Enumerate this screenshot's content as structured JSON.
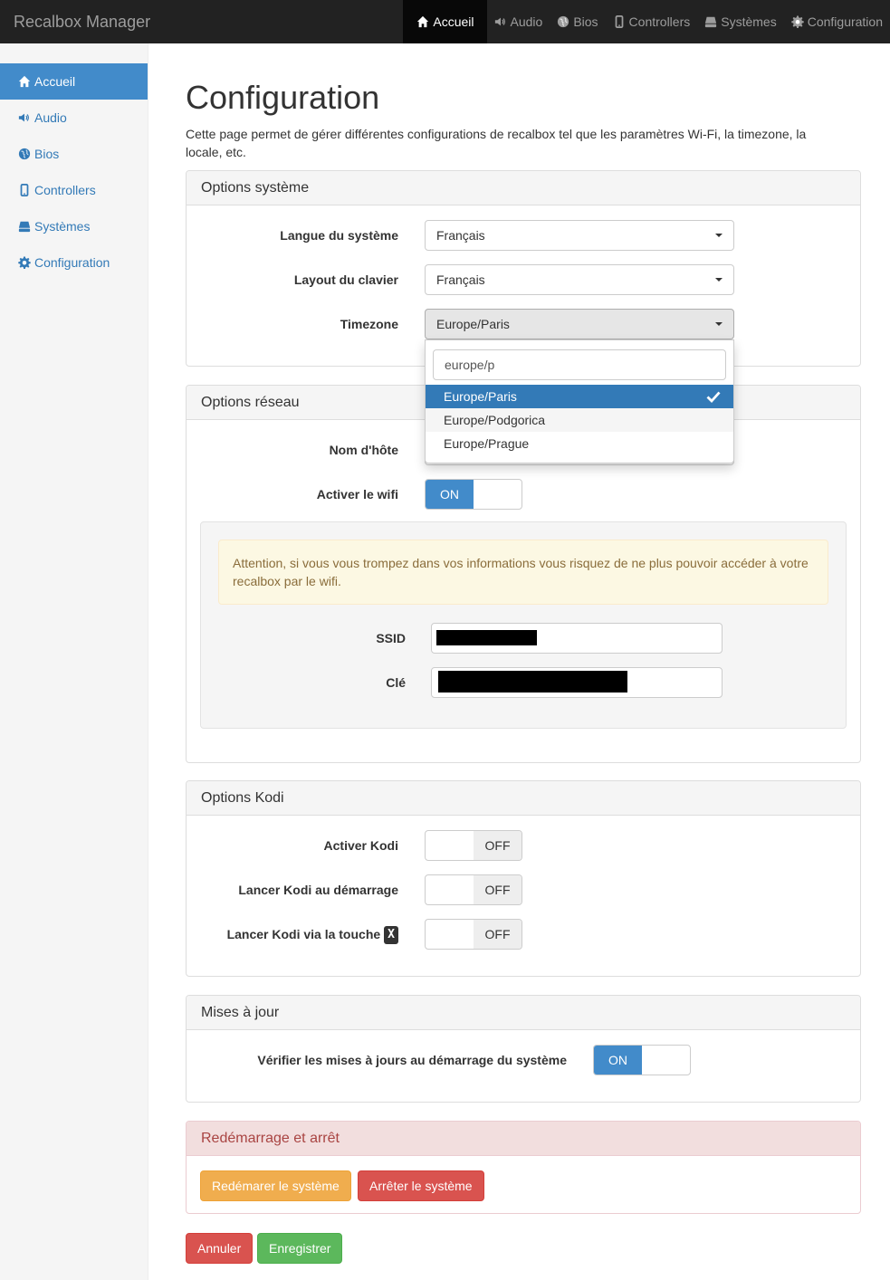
{
  "navbar": {
    "brand": "Recalbox Manager",
    "items": [
      {
        "label": "Accueil",
        "icon": "home-icon",
        "active": true
      },
      {
        "label": "Audio",
        "icon": "volume-icon"
      },
      {
        "label": "Bios",
        "icon": "globe-icon"
      },
      {
        "label": "Controllers",
        "icon": "phone-icon"
      },
      {
        "label": "Systèmes",
        "icon": "hdd-icon"
      },
      {
        "label": "Configuration",
        "icon": "gear-icon"
      }
    ]
  },
  "sidebar": {
    "items": [
      {
        "label": "Accueil",
        "icon": "home-icon",
        "active": true
      },
      {
        "label": "Audio",
        "icon": "volume-icon"
      },
      {
        "label": "Bios",
        "icon": "globe-icon"
      },
      {
        "label": "Controllers",
        "icon": "phone-icon"
      },
      {
        "label": "Systèmes",
        "icon": "hdd-icon"
      },
      {
        "label": "Configuration",
        "icon": "gear-icon"
      }
    ]
  },
  "page": {
    "title": "Configuration",
    "intro": "Cette page permet de gérer différentes configurations de recalbox tel que les paramètres Wi-Fi, la timezone, la locale, etc."
  },
  "system": {
    "heading": "Options système",
    "language_label": "Langue du système",
    "language_value": "Français",
    "keyboard_label": "Layout du clavier",
    "keyboard_value": "Français",
    "timezone_label": "Timezone",
    "timezone_value": "Europe/Paris"
  },
  "timezone_dropdown": {
    "search": "europe/p",
    "options": [
      "Europe/Paris",
      "Europe/Podgorica",
      "Europe/Prague"
    ],
    "selected": "Europe/Paris"
  },
  "network": {
    "heading": "Options réseau",
    "hostname_label": "Nom d'hôte",
    "wifi_label": "Activer le wifi",
    "wifi_state": "ON",
    "warning": "Attention, si vous vous trompez dans vos informations vous risquez de ne plus pouvoir accéder à votre recalbox par le wifi.",
    "ssid_label": "SSID",
    "key_label": "Clé"
  },
  "kodi": {
    "heading": "Options Kodi",
    "enable_label": "Activer Kodi",
    "enable_state": "OFF",
    "startup_label": "Lancer Kodi au démarrage",
    "startup_state": "OFF",
    "button_label": "Lancer Kodi via la touche",
    "button_key": "X",
    "button_state": "OFF"
  },
  "updates": {
    "heading": "Mises à jour",
    "check_label": "Vérifier les mises à jours au démarrage du système",
    "check_state": "ON"
  },
  "power": {
    "heading": "Redémarrage et arrêt",
    "reboot_label": "Redémarer le système",
    "shutdown_label": "Arrêter le système"
  },
  "actions": {
    "cancel_label": "Annuler",
    "save_label": "Enregistrer"
  },
  "colors": {
    "navbar": "#222222",
    "primary": "#428bca",
    "warning": "#f0ad4e",
    "danger": "#d9534f",
    "success": "#5cb85c"
  }
}
